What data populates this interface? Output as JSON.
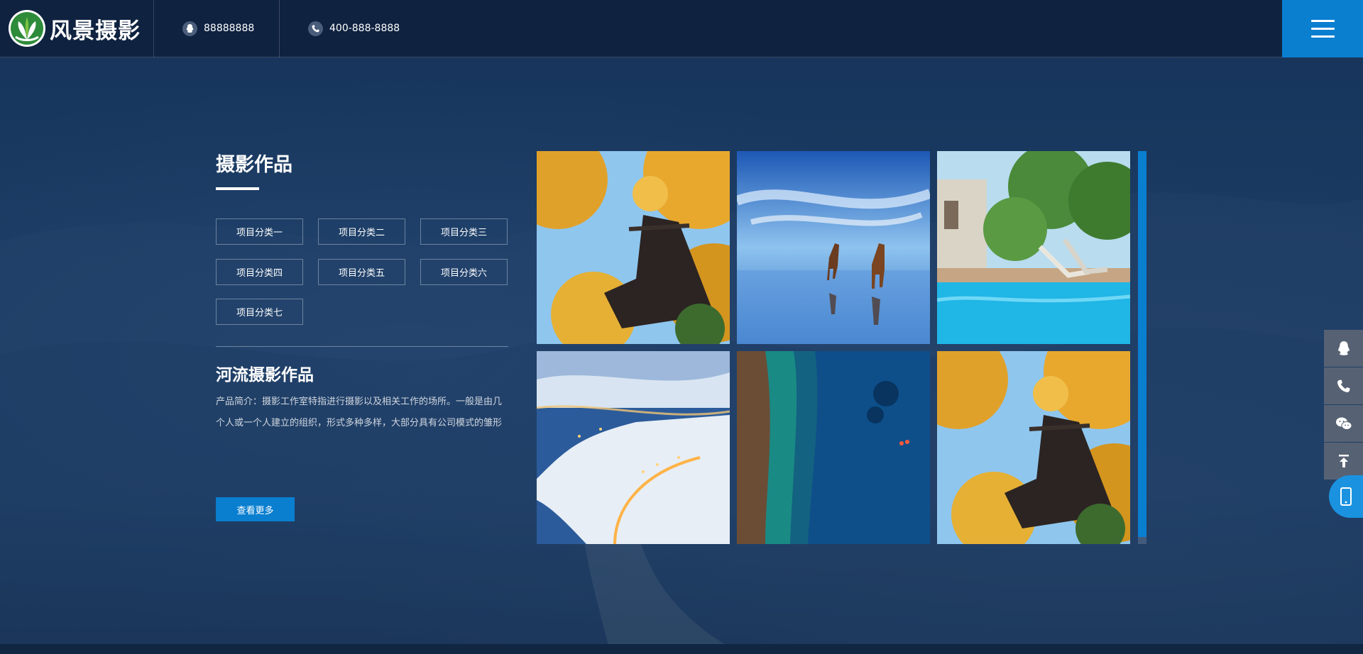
{
  "header": {
    "logo_text": "风景摄影",
    "qq": "88888888",
    "phone": "400-888-8888"
  },
  "section": {
    "title": "摄影作品",
    "categories": [
      "项目分类一",
      "项目分类二",
      "项目分类三",
      "项目分类四",
      "项目分类五",
      "项目分类六",
      "项目分类七"
    ]
  },
  "work": {
    "title": "河流摄影作品",
    "description": "产品简介：摄影工作室特指进行摄影以及相关工作的场所。一般是由几个人或一个人建立的组织，形式多种多样，大部分具有公司模式的雏形",
    "more_label": "查看更多"
  },
  "gallery": {
    "images": [
      "autumn-temple",
      "horses-on-mirror-lake",
      "garden-pool",
      "snowy-coast-town",
      "aerial-sea-rocks",
      "autumn-temple"
    ]
  },
  "float_bar": {
    "icons": [
      "qq-icon",
      "phone-icon",
      "wechat-icon",
      "back-to-top-icon",
      "mobile-icon"
    ]
  },
  "colors": {
    "accent": "#0a7fd0",
    "header_bg": "#0f2240",
    "page_bg": "#1a3a62"
  }
}
